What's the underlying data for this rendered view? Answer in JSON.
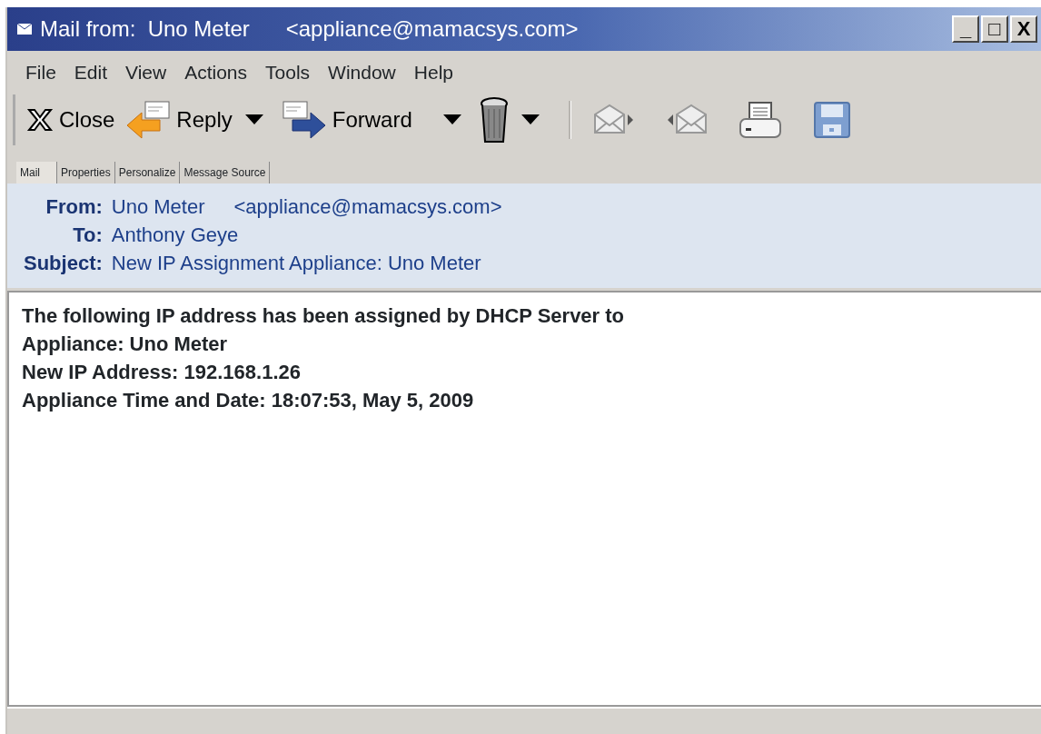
{
  "window": {
    "title": "Mail from:  Uno Meter      <appliance@mamacsys.com>",
    "controls": [
      "_",
      "□",
      "X"
    ]
  },
  "menu": [
    "File",
    "Edit",
    "View",
    "Actions",
    "Tools",
    "Window",
    "Help"
  ],
  "toolbar": [
    {
      "kind": "close",
      "label": "Close"
    },
    {
      "kind": "reply",
      "label": "Reply"
    },
    {
      "kind": "forward",
      "label": "Forward"
    },
    {
      "kind": "delete"
    },
    {
      "kind": "separator"
    },
    {
      "kind": "next"
    },
    {
      "kind": "previous"
    },
    {
      "kind": "print"
    },
    {
      "kind": "save"
    }
  ],
  "tabs": [
    {
      "label": "Mail",
      "selected": true
    },
    {
      "label": "Properties",
      "selected": false
    },
    {
      "label": "Personalize",
      "selected": false
    },
    {
      "label": "Message Source",
      "selected": false
    }
  ],
  "headers": [
    {
      "label": "From:",
      "value": "Uno Meter",
      "extra": "<appliance@mamacsys.com>"
    },
    {
      "label": "To:",
      "value": "Anthony Geye"
    },
    {
      "label": "Subject:",
      "value": "New IP  Assignment Appliance: Uno Meter"
    }
  ],
  "body": [
    "The following IP address has been assigned by DHCP Server to",
    "Appliance: Uno Meter",
    "New IP Address: 192.168.1.26",
    "Appliance Time and Date: 18:07:53,  May 5, 2009"
  ]
}
